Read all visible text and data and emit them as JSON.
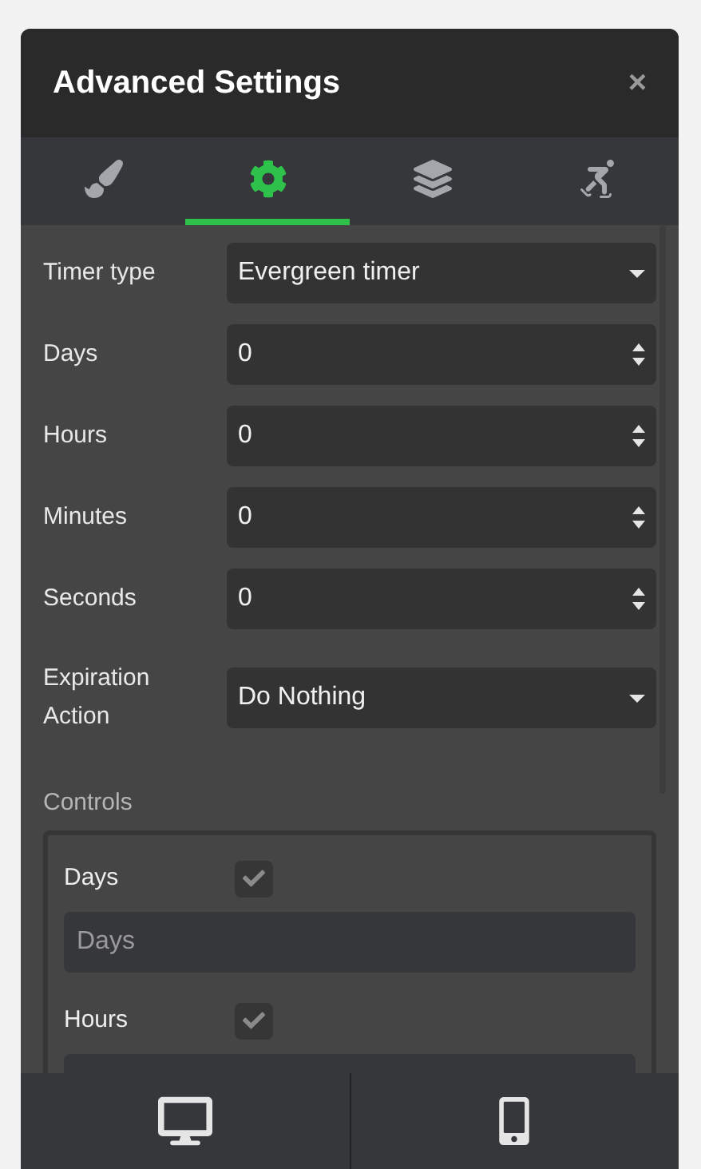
{
  "window": {
    "title": "Advanced Settings",
    "close": "×"
  },
  "tabs": [
    {
      "kind": "brush",
      "selected": false
    },
    {
      "kind": "gear",
      "selected": true
    },
    {
      "kind": "layers",
      "selected": false
    },
    {
      "kind": "skater",
      "selected": false
    }
  ],
  "fields": [
    {
      "label": "Timer type",
      "kind": "select",
      "value": "Evergreen timer"
    },
    {
      "label": "Days",
      "kind": "number",
      "value": "0"
    },
    {
      "label": "Hours",
      "kind": "number",
      "value": "0"
    },
    {
      "label": "Minutes",
      "kind": "number",
      "value": "0"
    },
    {
      "label": "Seconds",
      "kind": "number",
      "value": "0"
    },
    {
      "label": "Expiration Action",
      "kind": "select",
      "value": "Do Nothing"
    }
  ],
  "controls": {
    "label": "Controls",
    "items": [
      {
        "label": "Days",
        "checked": true,
        "placeholder": "Days"
      },
      {
        "label": "Hours",
        "checked": true
      }
    ]
  },
  "footer": [
    {
      "kind": "desktop"
    },
    {
      "kind": "mobile"
    }
  ]
}
